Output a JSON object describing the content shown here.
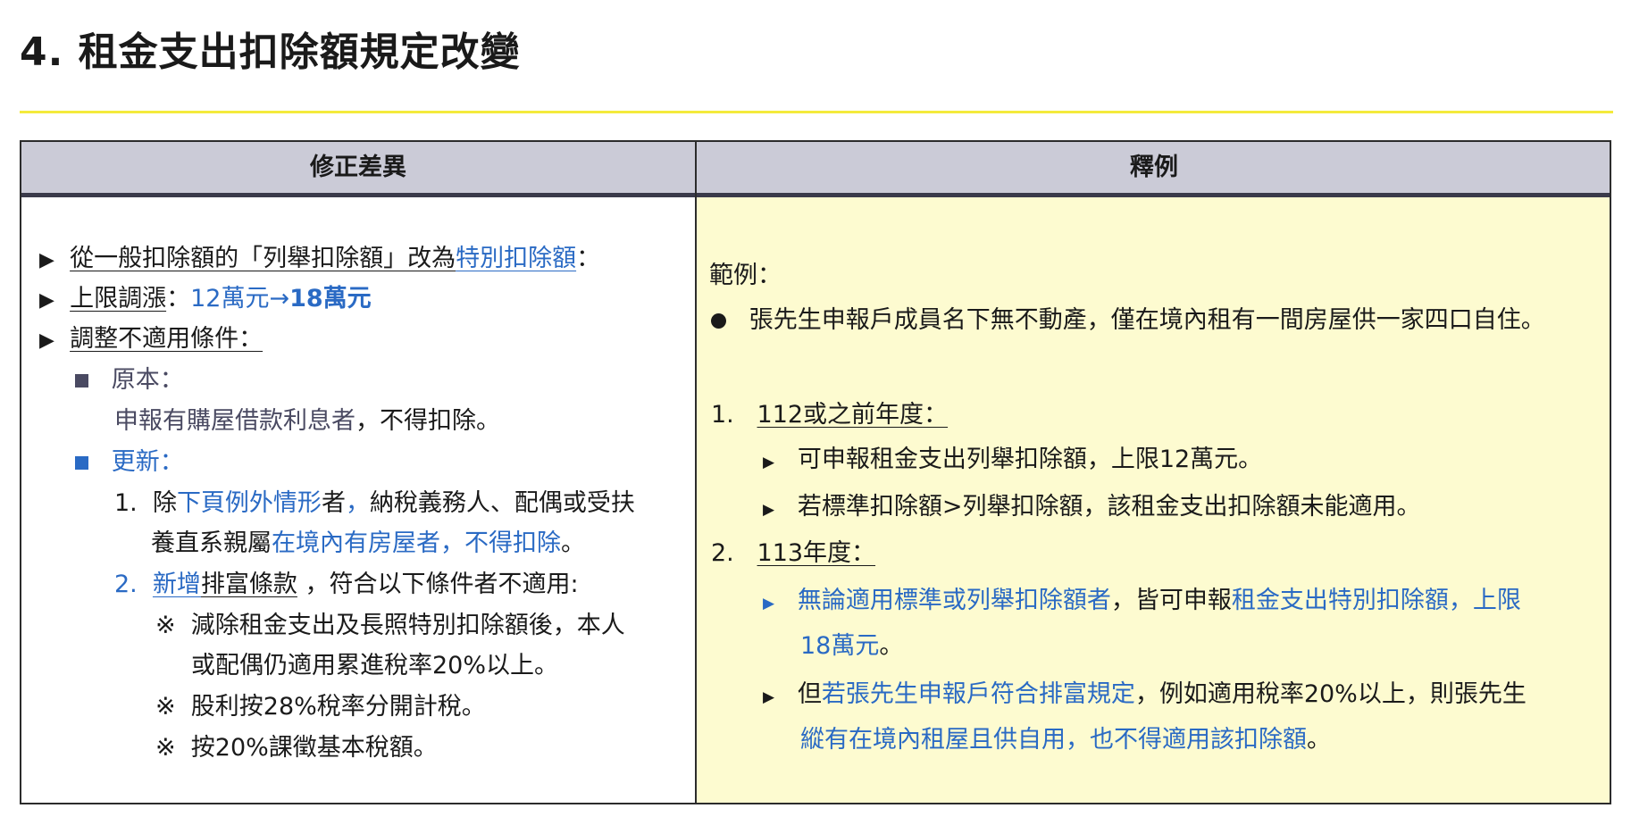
{
  "title": "4. 租金支出扣除額規定改變",
  "table": {
    "header_left": "修正差異",
    "header_right": "釋例"
  },
  "left": {
    "b1_pre": "從一般扣除額的「列舉扣除額」改為",
    "b1_link": "特別扣除額",
    "b1_post": "：",
    "b2_label": "上限調漲",
    "b2_colon": "：",
    "b2_old": "12萬元→",
    "b2_new": "18萬元",
    "b3": "調整不適用條件：",
    "orig_label": "原本：",
    "orig_a": "申報有購屋借款利息者",
    "orig_b": "，不得扣除。",
    "upd_label": "更新：",
    "i1_num": "1.",
    "i1_a": "除",
    "i1_b": "下頁例外情形",
    "i1_c": "者",
    "i1_d": "，",
    "i1_e": "納稅義務人、配偶或受扶",
    "i1_f": "養直系親屬",
    "i1_g": "在境內有房屋者，不得扣除",
    "i1_h": "。",
    "i2_num": "2.",
    "i2_a": "新增",
    "i2_b": "排富條款",
    "i2_c": " ，符合以下條件者不適用:",
    "x_mark": "※",
    "x1a": "減除租金支出及長照特別扣除額後，本人",
    "x1b": "或配偶仍適用累進稅率20%以上。",
    "x2": "股利按28%稅率分開計稅。",
    "x3": "按20%課徵基本稅額。"
  },
  "right": {
    "ex_label": "範例：",
    "ex_text": "張先生申報戶成員名下無不動產，僅在境內租有一間房屋供一家四口自住。",
    "y1_num": "1.",
    "y1_label": "112或之前年度：",
    "y1_b1": "可申報租金支出列舉扣除額，上限12萬元。",
    "y1_b2": "若標準扣除額>列舉扣除額，該租金支出扣除額未能適用。",
    "y2_num": "2.",
    "y2_label": "113年度：",
    "y2_b1_a": "無論適用標準或列舉扣除額者",
    "y2_b1_b": "，皆可申報",
    "y2_b1_c": "租金支出特別扣除額，上限",
    "y2_b1_d": "18萬元",
    "y2_b1_e": "。",
    "y2_b2_a": "但",
    "y2_b2_b": "若張先生申報戶符合排富規定",
    "y2_b2_c": "，例如適用稅率20%以上，則張先生",
    "y2_b2_d": "縱有在境內租屋且供自用，也不得適用該扣除額",
    "y2_b2_e": "。"
  },
  "icons": {
    "arrow": "triangle-right-icon",
    "square": "square-bullet-icon",
    "circle": "circle-bullet-icon"
  },
  "colors": {
    "accent_blue": "#2a6ac4",
    "rule_yellow": "#f4ea3c",
    "header_gray": "#cbcbd7",
    "panel_yellow": "#fdfbd0"
  }
}
